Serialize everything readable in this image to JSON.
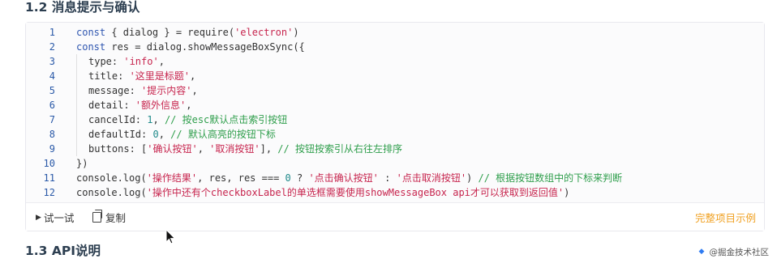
{
  "section": {
    "title": "1.2 消息提示与确认",
    "next_title": "1.3 API说明"
  },
  "code": {
    "line_numbers": [
      "1",
      "2",
      "3",
      "4",
      "5",
      "6",
      "7",
      "8",
      "9",
      "10",
      "11",
      "12"
    ],
    "lines": [
      {
        "indent": false,
        "tokens": [
          {
            "t": "kw",
            "v": "const"
          },
          {
            "t": "pl",
            "v": " { dialog } = require("
          },
          {
            "t": "str",
            "v": "'electron'"
          },
          {
            "t": "pl",
            "v": ")"
          }
        ]
      },
      {
        "indent": false,
        "tokens": [
          {
            "t": "kw",
            "v": "const"
          },
          {
            "t": "pl",
            "v": " res = dialog.showMessageBoxSync({"
          }
        ]
      },
      {
        "indent": true,
        "tokens": [
          {
            "t": "pl",
            "v": "type: "
          },
          {
            "t": "str",
            "v": "'info'"
          },
          {
            "t": "pl",
            "v": ","
          }
        ]
      },
      {
        "indent": true,
        "tokens": [
          {
            "t": "pl",
            "v": "title: "
          },
          {
            "t": "str",
            "v": "'这里是标题'"
          },
          {
            "t": "pl",
            "v": ","
          }
        ]
      },
      {
        "indent": true,
        "tokens": [
          {
            "t": "pl",
            "v": "message: "
          },
          {
            "t": "str",
            "v": "'提示内容'"
          },
          {
            "t": "pl",
            "v": ","
          }
        ]
      },
      {
        "indent": true,
        "tokens": [
          {
            "t": "pl",
            "v": "detail: "
          },
          {
            "t": "str",
            "v": "'额外信息'"
          },
          {
            "t": "pl",
            "v": ","
          }
        ]
      },
      {
        "indent": true,
        "tokens": [
          {
            "t": "pl",
            "v": "cancelId: "
          },
          {
            "t": "num",
            "v": "1"
          },
          {
            "t": "pl",
            "v": ", "
          },
          {
            "t": "com",
            "v": "// 按esc默认点击索引按钮"
          }
        ]
      },
      {
        "indent": true,
        "tokens": [
          {
            "t": "pl",
            "v": "defaultId: "
          },
          {
            "t": "num",
            "v": "0"
          },
          {
            "t": "pl",
            "v": ", "
          },
          {
            "t": "com",
            "v": "// 默认高亮的按钮下标"
          }
        ]
      },
      {
        "indent": true,
        "tokens": [
          {
            "t": "pl",
            "v": "buttons: ["
          },
          {
            "t": "str",
            "v": "'确认按钮'"
          },
          {
            "t": "pl",
            "v": ", "
          },
          {
            "t": "str",
            "v": "'取消按钮'"
          },
          {
            "t": "pl",
            "v": "], "
          },
          {
            "t": "com",
            "v": "// 按钮按索引从右往左排序"
          }
        ]
      },
      {
        "indent": false,
        "tokens": [
          {
            "t": "pl",
            "v": "})"
          }
        ]
      },
      {
        "indent": false,
        "tokens": [
          {
            "t": "pl",
            "v": "console.log("
          },
          {
            "t": "str",
            "v": "'操作结果'"
          },
          {
            "t": "pl",
            "v": ", res, res === "
          },
          {
            "t": "num",
            "v": "0"
          },
          {
            "t": "pl",
            "v": " ? "
          },
          {
            "t": "str",
            "v": "'点击确认按钮'"
          },
          {
            "t": "pl",
            "v": " : "
          },
          {
            "t": "str",
            "v": "'点击取消按钮'"
          },
          {
            "t": "pl",
            "v": ") "
          },
          {
            "t": "com",
            "v": "// 根据按钮数组中的下标来判断"
          }
        ]
      },
      {
        "indent": false,
        "tokens": [
          {
            "t": "pl",
            "v": "console.log("
          },
          {
            "t": "str",
            "v": "'操作中还有个checkboxLabel的单选框需要使用showMessageBox api才可以获取到返回值'"
          },
          {
            "t": "pl",
            "v": ")"
          }
        ]
      }
    ]
  },
  "footer": {
    "try_label": "试一试",
    "copy_label": "复制",
    "example_link": "完整项目示例"
  },
  "watermark": "@掘金技术社区",
  "colors": {
    "keyword": "#2f56b0",
    "string": "#c7254e",
    "number": "#1f8a8a",
    "comment": "#2e9e4b",
    "link": "#f0a020"
  },
  "icons": {
    "try": "play-triangle-icon",
    "copy": "copy-icon",
    "watermark": "juejin-logo-icon"
  }
}
